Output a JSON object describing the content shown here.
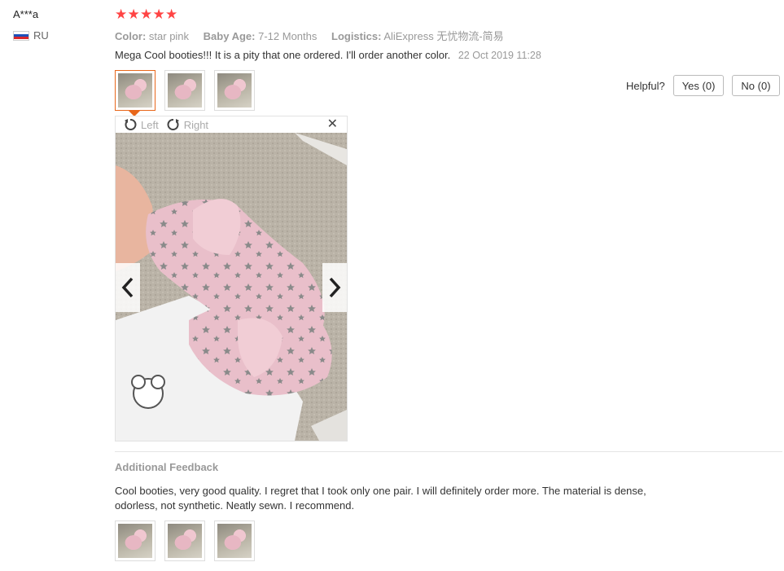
{
  "user": {
    "name": "A***a",
    "country": "RU"
  },
  "rating": {
    "stars": 5,
    "max": 5
  },
  "attributes": [
    {
      "label": "Color:",
      "value": "star pink"
    },
    {
      "label": "Baby Age:",
      "value": "7-12 Months"
    },
    {
      "label": "Logistics:",
      "value": "AliExpress 无忧物流-简易"
    }
  ],
  "review": {
    "text": "Mega Cool booties!!! It is a pity that one ordered. I'll order another color.",
    "date": "22 Oct 2019 11:28"
  },
  "helpful": {
    "label": "Helpful?",
    "yes": "Yes (0)",
    "no": "No (0)"
  },
  "viewer": {
    "rotate_left": "Left",
    "rotate_right": "Right",
    "close": "✕"
  },
  "additional": {
    "title": "Additional Feedback",
    "text": "Cool booties, very good quality. I regret that I took only one pair. I will definitely order more. The material is dense, odorless, not synthetic. Neatly sewn. I recommend."
  },
  "colors": {
    "star": "#ff4747",
    "accent": "#e8671b",
    "muted": "#999999"
  },
  "icons": {
    "star": "star-icon",
    "rotate_left": "rotate-left-icon",
    "rotate_right": "rotate-right-icon",
    "close": "close-icon",
    "prev": "chevron-left-icon",
    "next": "chevron-right-icon",
    "flag": "russia-flag-icon"
  }
}
